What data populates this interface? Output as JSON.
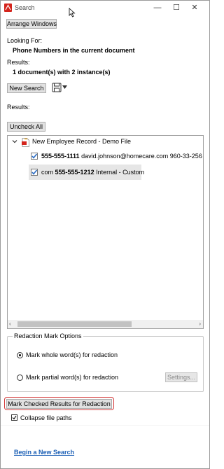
{
  "window": {
    "title": "Search",
    "app_icon": "acrobat-search-icon",
    "minimize": "—",
    "maximize": "☐",
    "close": "✕"
  },
  "toolbar": {
    "arrange_windows": "Arrange Windows"
  },
  "search": {
    "looking_for_label": "Looking For:",
    "looking_for_value": "Phone Numbers in the current document",
    "results_label": "Results:",
    "results_value": "1 document(s) with 2 instance(s)",
    "new_search": "New Search",
    "save_icon": "save-icon",
    "results_label_2": "Results:",
    "uncheck_all": "Uncheck All"
  },
  "results_tree": {
    "document": "New Employee Record - Demo File",
    "instances": [
      {
        "match": "555-555-1111",
        "context": "david.johnson@homecare.com 960-33-256",
        "checked": true
      },
      {
        "prefix": "com",
        "match": "555-555-1212",
        "context": "Internal - Custom",
        "checked": true
      }
    ],
    "scroll_left": "‹",
    "scroll_right": "›"
  },
  "redaction_options": {
    "title": "Redaction Mark Options",
    "whole_word": "Mark whole word(s) for redaction",
    "partial_word": "Mark partial word(s) for redaction",
    "selected": "whole_word",
    "settings": "Settings..."
  },
  "actions": {
    "mark_checked": "Mark Checked Results for Redaction",
    "collapse_file_paths": "Collapse file paths",
    "collapse_checked": true
  },
  "footer": {
    "begin_new_search": "Begin a New Search"
  },
  "colors": {
    "accent_red": "#d33a3a",
    "link_blue": "#1b5fb5",
    "checkbox_blue": "#2b6cc4"
  }
}
